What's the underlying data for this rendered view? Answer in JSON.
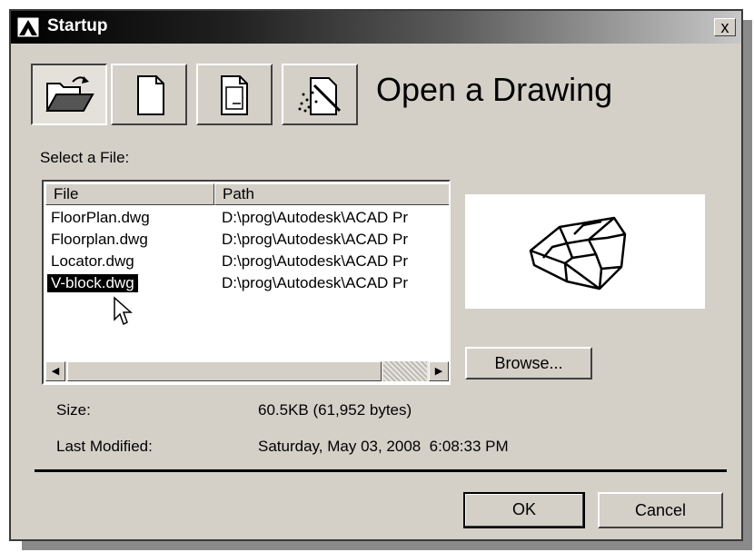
{
  "window": {
    "title": "Startup",
    "close_label": "x"
  },
  "toolbar": {
    "buttons": [
      {
        "name": "open-drawing",
        "icon": "open-folder-icon",
        "pressed": true
      },
      {
        "name": "start-from-scratch",
        "icon": "blank-page-icon",
        "pressed": false
      },
      {
        "name": "use-template",
        "icon": "template-page-icon",
        "pressed": false
      },
      {
        "name": "use-wizard",
        "icon": "wizard-icon",
        "pressed": false
      }
    ]
  },
  "heading": "Open a Drawing",
  "select_label": "Select a File:",
  "file_list": {
    "columns": [
      "File",
      "Path"
    ],
    "rows": [
      {
        "file": "FloorPlan.dwg",
        "path": "D:\\prog\\Autodesk\\ACAD Pr",
        "selected": false
      },
      {
        "file": "Floorplan.dwg",
        "path": "D:\\prog\\Autodesk\\ACAD Pr",
        "selected": false
      },
      {
        "file": "Locator.dwg",
        "path": "D:\\prog\\Autodesk\\ACAD Pr",
        "selected": false
      },
      {
        "file": "V-block.dwg",
        "path": "D:\\prog\\Autodesk\\ACAD Pr",
        "selected": true
      }
    ]
  },
  "buttons": {
    "browse": "Browse...",
    "ok": "OK",
    "cancel": "Cancel"
  },
  "info": {
    "size_label": "Size:",
    "size_value": "60.5KB (61,952 bytes)",
    "modified_label": "Last Modified:",
    "modified_value": "Saturday, May 03, 2008  6:08:33 PM"
  }
}
